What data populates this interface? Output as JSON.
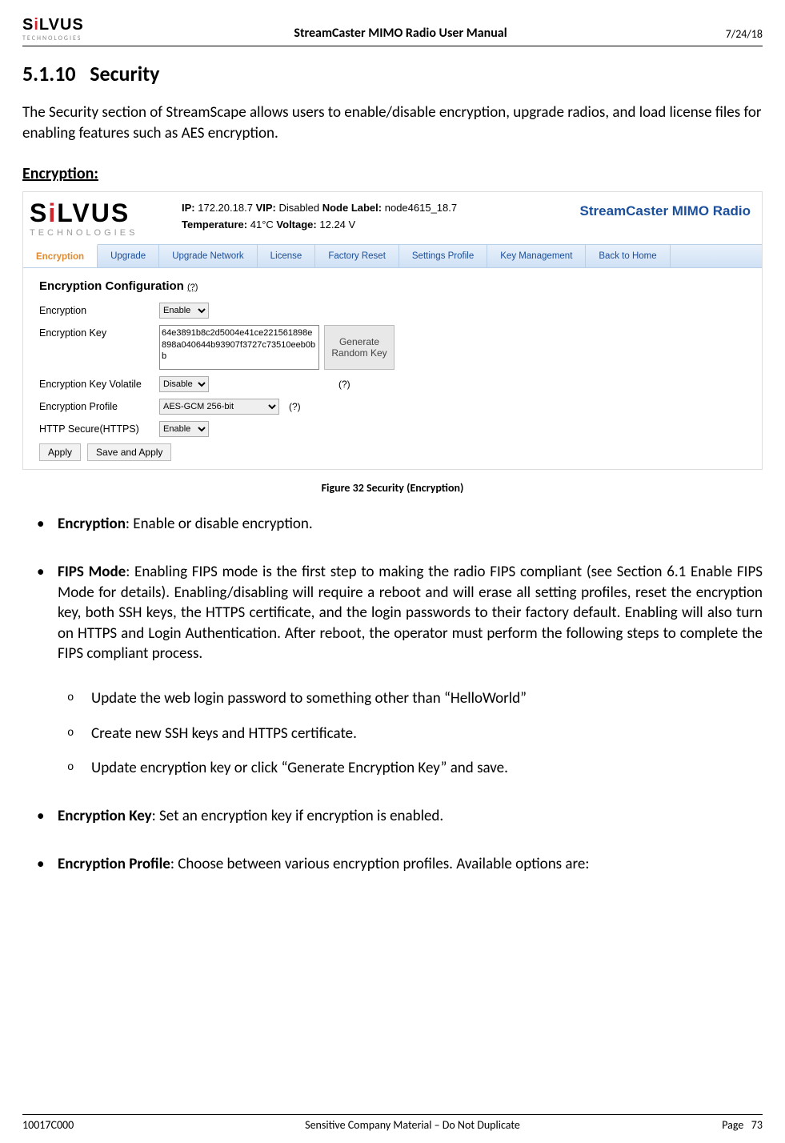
{
  "header": {
    "logo_brand": "SiLVUS",
    "logo_sub": "TECHNOLOGIES",
    "title": "StreamCaster MIMO Radio User Manual",
    "date": "7/24/18"
  },
  "section": {
    "number": "5.1.10",
    "title": "Security",
    "intro": "The Security section of StreamScape allows users to enable/disable encryption, upgrade radios, and load license files for enabling features such as AES encryption.",
    "subheading": "Encryption:"
  },
  "app": {
    "ip_label": "IP:",
    "ip": "172.20.18.7",
    "vip_label": "VIP:",
    "vip": "Disabled",
    "node_label_label": "Node Label:",
    "node_label": "node4615_18.7",
    "temp_label": "Temperature:",
    "temp": "41°C",
    "volt_label": "Voltage:",
    "volt": "12.24 V",
    "brand": "StreamCaster MIMO Radio",
    "tabs": [
      "Encryption",
      "Upgrade",
      "Upgrade Network",
      "License",
      "Factory Reset",
      "Settings Profile",
      "Key Management",
      "Back to Home"
    ],
    "form_title": "Encryption Configuration",
    "help_mark": "(?)",
    "fields": {
      "encryption_label": "Encryption",
      "encryption_value": "Enable",
      "key_label": "Encryption Key",
      "key_value": "64e3891b8c2d5004e41ce221561898e898a040644b93907f3727c73510eeb0bb",
      "gen_btn": "Generate Random Key",
      "volatile_label": "Encryption Key Volatile",
      "volatile_value": "Disable",
      "profile_label": "Encryption Profile",
      "profile_value": "AES-GCM 256-bit",
      "https_label": "HTTP Secure(HTTPS)",
      "https_value": "Enable"
    },
    "buttons": {
      "apply": "Apply",
      "save_apply": "Save and Apply"
    }
  },
  "figure_caption": "Figure 32 Security (Encryption)",
  "bullets": {
    "b1_term": "Encryption",
    "b1_rest": ": Enable or disable encryption.",
    "b2_term": "FIPS Mode",
    "b2_rest": ": Enabling FIPS mode is the first step to making the radio FIPS compliant (see Section 6.1 Enable FIPS Mode for details). Enabling/disabling will require a reboot and will erase all setting profiles, reset the encryption key, both SSH keys, the HTTPS certificate, and the login passwords to their factory default. Enabling will also turn on HTTPS and Login Authentication. After reboot, the operator must perform the following steps to complete the FIPS compliant process.",
    "b2_sub1": "Update the web login password to something other than “HelloWorld”",
    "b2_sub2": "Create new SSH keys and HTTPS certificate.",
    "b2_sub3": "Update encryption key or click “Generate Encryption Key” and save.",
    "b3_term": "Encryption Key",
    "b3_rest": ": Set an encryption key if encryption is enabled.",
    "b4_term": "Encryption Profile",
    "b4_rest": ": Choose between various encryption profiles. Available options are:"
  },
  "footer": {
    "left": "10017C000",
    "center": "Sensitive Company Material – Do Not Duplicate",
    "page_label": "Page",
    "page_num": "73"
  }
}
